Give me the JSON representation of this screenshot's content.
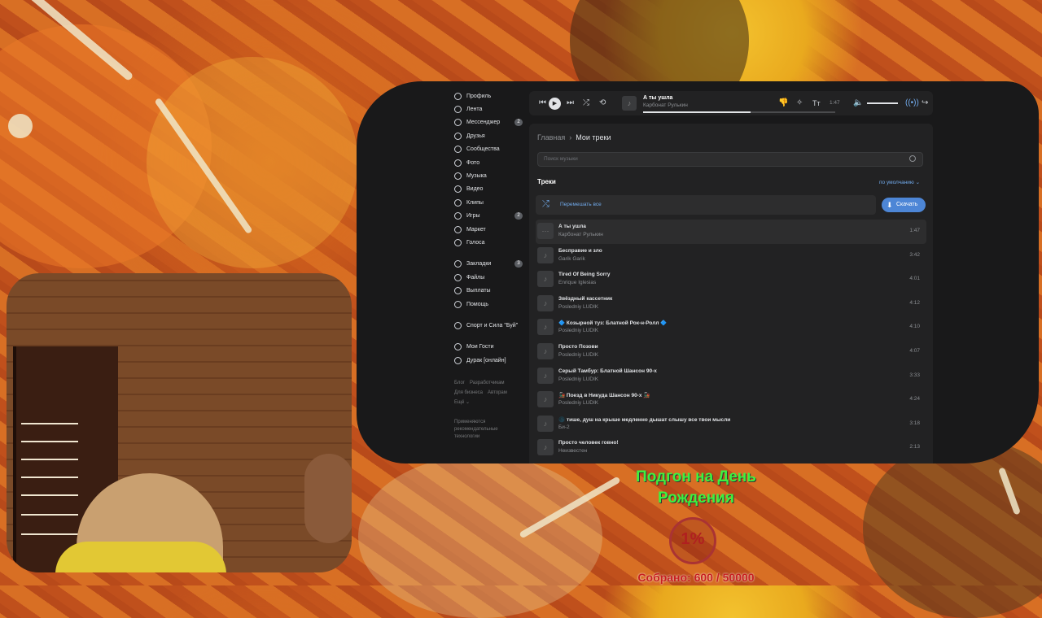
{
  "sidebar": {
    "items": [
      {
        "label": "Профиль",
        "icon": "profile-icon",
        "count": ""
      },
      {
        "label": "Лента",
        "icon": "news-icon",
        "count": ""
      },
      {
        "label": "Мессенджер",
        "icon": "messenger-icon",
        "count": "2"
      },
      {
        "label": "Друзья",
        "icon": "friends-icon",
        "count": ""
      },
      {
        "label": "Сообщества",
        "icon": "communities-icon",
        "count": ""
      },
      {
        "label": "Фото",
        "icon": "photo-icon",
        "count": ""
      },
      {
        "label": "Музыка",
        "icon": "music-icon",
        "count": ""
      },
      {
        "label": "Видео",
        "icon": "video-icon",
        "count": ""
      },
      {
        "label": "Клипы",
        "icon": "clips-icon",
        "count": ""
      },
      {
        "label": "Игры",
        "icon": "games-icon",
        "count": "2"
      },
      {
        "label": "Маркет",
        "icon": "market-icon",
        "count": ""
      },
      {
        "label": "Голоса",
        "icon": "votes-icon",
        "count": ""
      }
    ],
    "items2": [
      {
        "label": "Закладки",
        "icon": "bookmarks-icon",
        "count": "3"
      },
      {
        "label": "Файлы",
        "icon": "files-icon",
        "count": ""
      },
      {
        "label": "Выплаты",
        "icon": "payouts-icon",
        "count": ""
      },
      {
        "label": "Помощь",
        "icon": "help-icon",
        "count": ""
      }
    ],
    "items3": [
      {
        "label": "Спорт и Сила \"Буй\"",
        "icon": "group-icon"
      }
    ],
    "items4": [
      {
        "label": "Мои Гости",
        "icon": "guests-icon"
      },
      {
        "label": "Дурак [онлайн]",
        "icon": "game-icon"
      }
    ],
    "footer": [
      "Блог",
      "Разработчикам",
      "Для бизнеса",
      "Авторам",
      "Ещё ⌄"
    ],
    "rec_note": "Применяются рекомендательные технологии"
  },
  "player": {
    "title": "А ты ушла",
    "artist": "Карбонат Рулькин",
    "time": "1:47",
    "progress": 0.56,
    "volume": 0.8
  },
  "content": {
    "breadcrumb_home": "Главная",
    "breadcrumb_sep": "›",
    "breadcrumb_current": "Мои треки",
    "search_placeholder": "Поиск музыки",
    "tracks_heading": "Треки",
    "sort_label": "по умолчанию ⌄",
    "shuffle_label": "Перемешать все",
    "download_label": "Скачать"
  },
  "tracks": [
    {
      "title": "А ты ушла",
      "artist": "Карбонат Рулькин",
      "duration": "1:47",
      "thumb": "⋯",
      "active": true
    },
    {
      "title": "Бесправие и зло",
      "artist": "Garik Garik",
      "duration": "3:42",
      "thumb": "♪"
    },
    {
      "title": "Tired Of Being Sorry",
      "artist": "Enrique Iglesias",
      "duration": "4:01",
      "thumb": "♪"
    },
    {
      "title": "Звёздный кассетник",
      "artist": "Posledniy LUDIK",
      "duration": "4:12",
      "thumb": "♪"
    },
    {
      "title": "🔷 Козырной туз: Блатной Рок-н-Ролл 🔷",
      "artist": "Posledniy LUDIK",
      "duration": "4:10",
      "thumb": "♪"
    },
    {
      "title": "Просто Позови",
      "artist": "Posledniy LUDIK",
      "duration": "4:07",
      "thumb": "♪"
    },
    {
      "title": "Серый Тамбур: Блатной Шансон 90-х",
      "artist": "Posledniy LUDIK",
      "duration": "3:33",
      "thumb": "♪"
    },
    {
      "title": "🚂 Поезд в Никуда Шансон 90-х 🚂",
      "artist": "Posledniy LUDIK",
      "duration": "4:24",
      "thumb": "♪"
    },
    {
      "title": "🌑 тише, душ на крыше медленно дышат слышу все твои мысли",
      "artist": "Би-2",
      "duration": "3:18",
      "thumb": "♪"
    },
    {
      "title": "Просто человек говно!",
      "artist": "Неизвестен",
      "duration": "2:13",
      "thumb": "♪"
    }
  ],
  "overlay": {
    "goal_title": "Подгон на День Рождения",
    "percent": "1%",
    "collected": "Собрано: 600 / 50000"
  },
  "colors": {
    "accent": "#71aaeb",
    "button": "#4d86d6",
    "goal_green": "#3ef040",
    "goal_red": "#c82020"
  }
}
